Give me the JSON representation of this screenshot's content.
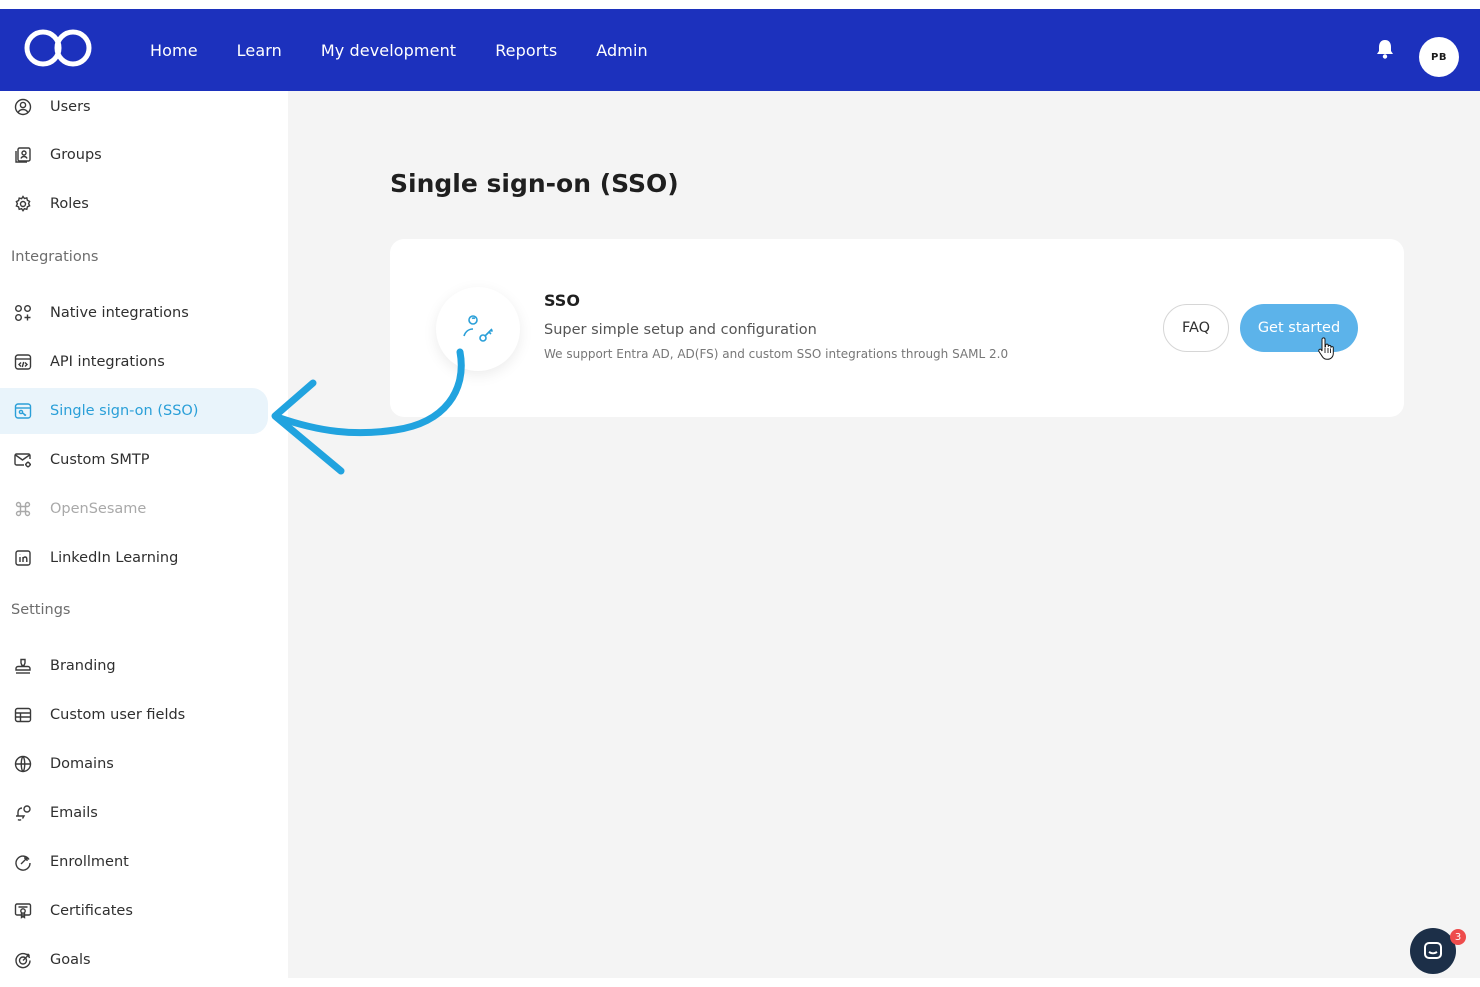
{
  "header": {
    "logo": "infinity-logo",
    "nav": [
      "Home",
      "Learn",
      "My development",
      "Reports",
      "Admin"
    ],
    "bell_icon": "bell-icon",
    "avatar_initials": "PB",
    "brand_color": "#1c31bd"
  },
  "sidebar": {
    "top_items": [
      {
        "label": "Users",
        "icon": "user-circle-icon"
      },
      {
        "label": "Groups",
        "icon": "groups-icon"
      },
      {
        "label": "Roles",
        "icon": "gear-icon"
      }
    ],
    "integrations_title": "Integrations",
    "integrations": [
      {
        "label": "Native integrations",
        "icon": "apps-icon"
      },
      {
        "label": "API integrations",
        "icon": "code-window-icon"
      },
      {
        "label": "Single sign-on (SSO)",
        "icon": "sso-window-icon",
        "active": true
      },
      {
        "label": "Custom SMTP",
        "icon": "mail-gear-icon"
      },
      {
        "label": "OpenSesame",
        "icon": "command-icon",
        "disabled": true
      },
      {
        "label": "LinkedIn Learning",
        "icon": "linkedin-icon"
      }
    ],
    "settings_title": "Settings",
    "settings": [
      {
        "label": "Branding",
        "icon": "stamp-icon"
      },
      {
        "label": "Custom user fields",
        "icon": "table-icon"
      },
      {
        "label": "Domains",
        "icon": "globe-icon"
      },
      {
        "label": "Emails",
        "icon": "email-bell-icon"
      },
      {
        "label": "Enrollment",
        "icon": "enroll-icon"
      },
      {
        "label": "Certificates",
        "icon": "certificate-icon"
      },
      {
        "label": "Goals",
        "icon": "target-icon"
      }
    ]
  },
  "main": {
    "title": "Single sign-on (SSO)",
    "card": {
      "icon": "user-key-icon",
      "title": "SSO",
      "subtitle": "Super simple setup and configuration",
      "description": "We support Entra AD, AD(FS) and custom SSO integrations through SAML 2.0",
      "faq_label": "FAQ",
      "start_label": "Get started"
    }
  },
  "chat": {
    "icon": "chat-bubble-icon",
    "badge": "3"
  },
  "colors": {
    "accent": "#2a9fd8",
    "button": "#5cb3ea",
    "background": "#f4f4f4"
  }
}
